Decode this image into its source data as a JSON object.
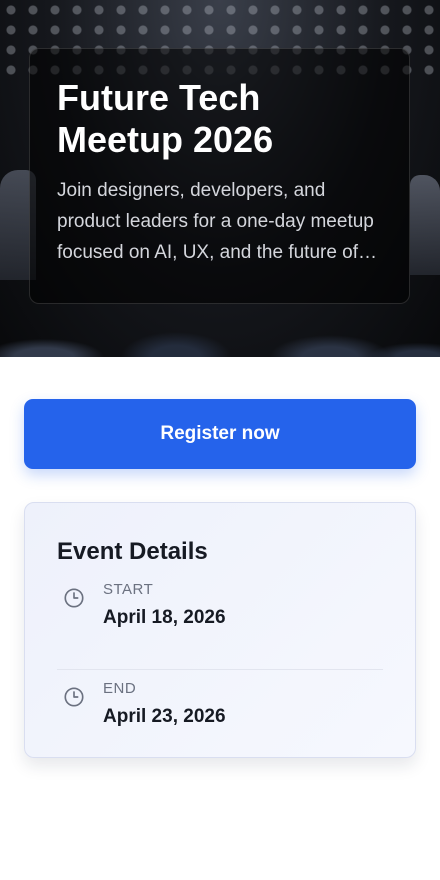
{
  "hero": {
    "title": "Future Tech Meetup 2026",
    "description": "Join designers, developers, and product leaders for a one-day meetup focused on AI, UX, and the future of technology."
  },
  "actions": {
    "register_label": "Register now"
  },
  "details": {
    "title": "Event Details",
    "items": [
      {
        "label": "START",
        "value": "April 18, 2026",
        "icon": "clock-icon"
      },
      {
        "label": "END",
        "value": "April 23, 2026",
        "icon": "clock-icon"
      }
    ]
  },
  "colors": {
    "accent": "#2563eb",
    "text_dark": "#161a23",
    "text_muted": "#6b7180"
  }
}
